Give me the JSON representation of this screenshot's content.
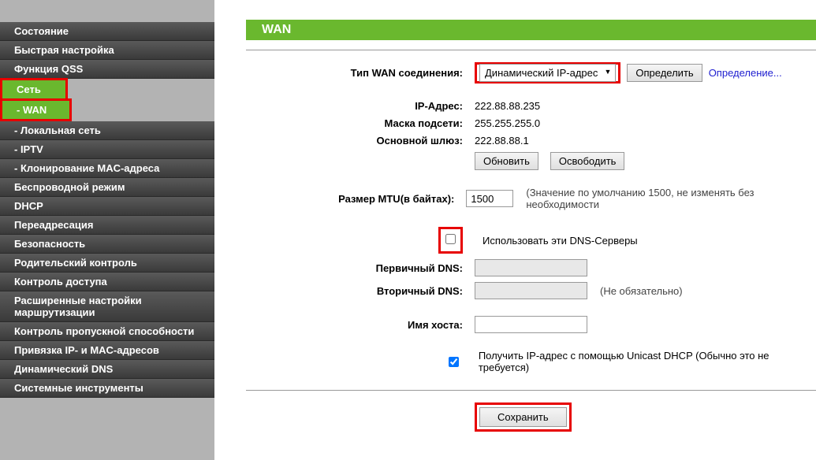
{
  "sidebar": {
    "items": [
      {
        "label": "Состояние"
      },
      {
        "label": "Быстрая настройка"
      },
      {
        "label": "Функция QSS"
      },
      {
        "label": "Сеть"
      },
      {
        "label": "- WAN"
      },
      {
        "label": "- Локальная сеть"
      },
      {
        "label": "- IPTV"
      },
      {
        "label": "- Клонирование MAC-адреса"
      },
      {
        "label": "Беспроводной режим"
      },
      {
        "label": "DHCP"
      },
      {
        "label": "Переадресация"
      },
      {
        "label": "Безопасность"
      },
      {
        "label": "Родительский контроль"
      },
      {
        "label": "Контроль доступа"
      },
      {
        "label": "Расширенные настройки маршрутизации"
      },
      {
        "label": "Контроль пропускной способности"
      },
      {
        "label": "Привязка IP- и MAC-адресов"
      },
      {
        "label": "Динамический DNS"
      },
      {
        "label": "Системные инструменты"
      }
    ]
  },
  "page": {
    "title": "WAN",
    "wan_type_label": "Тип WAN соединения:",
    "wan_type_value": "Динамический IP-адрес",
    "detect_btn": "Определить",
    "detect_link": "Определение...",
    "ip_label": "IP-Адрес:",
    "ip_value": "222.88.88.235",
    "mask_label": "Маска подсети:",
    "mask_value": "255.255.255.0",
    "gateway_label": "Основной шлюз:",
    "gateway_value": "222.88.88.1",
    "refresh_btn": "Обновить",
    "release_btn": "Освободить",
    "mtu_label": "Размер MTU(в байтах):",
    "mtu_value": "1500",
    "mtu_hint": "(Значение по умолчанию 1500, не изменять без необходимости",
    "use_dns_label": "Использовать эти DNS-Серверы",
    "primary_dns_label": "Первичный DNS:",
    "secondary_dns_label": "Вторичный DNS:",
    "secondary_hint": "(Не обязательно)",
    "hostname_label": "Имя хоста:",
    "unicast_label": "Получить IP-адрес с помощью Unicast DHCP (Обычно это не требуется)",
    "save_btn": "Сохранить"
  }
}
